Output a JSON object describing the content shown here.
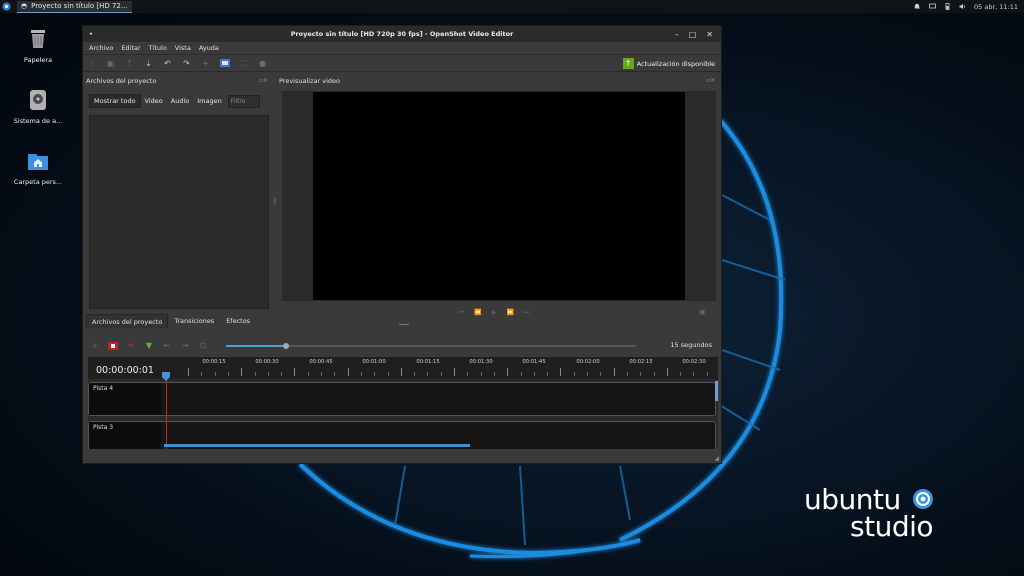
{
  "panel": {
    "task_title": "Proyecto sin título [HD 72...",
    "clock": "05 abr, 11:11"
  },
  "desktop": {
    "icons": [
      {
        "label": "Papelera"
      },
      {
        "label": "Sistema de a..."
      },
      {
        "label": "Carpeta pers..."
      }
    ],
    "logo_line1": "ubuntu",
    "logo_line2": "studio"
  },
  "window": {
    "title": "Proyecto sin título [HD 720p 30 fps] - OpenShot Video Editor",
    "menu": [
      "Archivo",
      "Editar",
      "Título",
      "Vista",
      "Ayuda"
    ],
    "update_label": "Actualización disponible",
    "project_files_title": "Archivos del proyecto",
    "preview_title": "Previsualizar video",
    "file_tabs": [
      "Mostrar todo",
      "Video",
      "Audio",
      "Imagen"
    ],
    "filter_placeholder": "Filtro",
    "bottom_tabs": [
      "Archivos del proyecto",
      "Transiciones",
      "Efectos"
    ],
    "zoom_label": "15 segundos",
    "timecode": "00:00:00:01",
    "ruler_labels": [
      "00:00:15",
      "00:00:30",
      "00:00:45",
      "00:01:00",
      "00:01:15",
      "00:01:30",
      "00:01:45",
      "00:02:00",
      "00:02:15",
      "00:02:30"
    ],
    "tracks": [
      "Pista 4",
      "Pista 3"
    ]
  },
  "colors": {
    "accent": "#4aa0e0",
    "update_green": "#6aa51e",
    "playhead": "#d02020"
  }
}
